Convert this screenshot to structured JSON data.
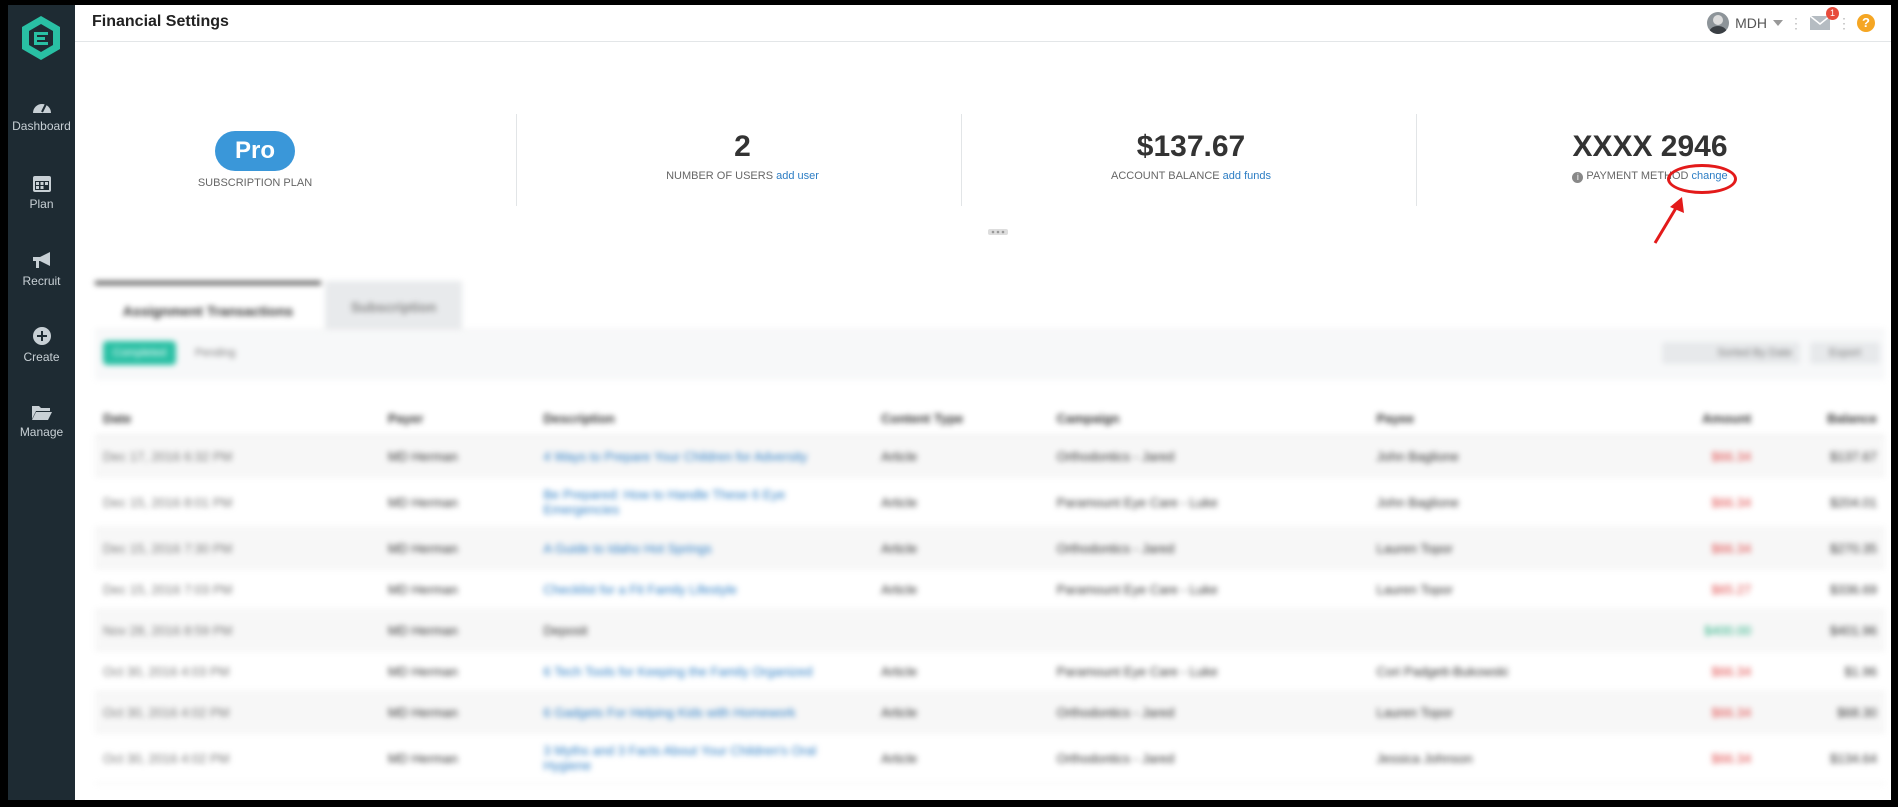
{
  "app": {
    "page_title": "Financial Settings",
    "nav": [
      {
        "label": "Dashboard",
        "icon": "dashboard-icon"
      },
      {
        "label": "Plan",
        "icon": "calendar-icon"
      },
      {
        "label": "Recruit",
        "icon": "megaphone-icon"
      },
      {
        "label": "Create",
        "icon": "plus-circle-icon"
      },
      {
        "label": "Manage",
        "icon": "folder-icon"
      }
    ]
  },
  "topbar": {
    "user_initials": "MDH",
    "notification_count": "1",
    "help_label": "?"
  },
  "stats": {
    "plan": {
      "value": "Pro",
      "caption": "SUBSCRIPTION PLAN"
    },
    "users": {
      "value": "2",
      "caption": "NUMBER OF USERS",
      "link": "add user"
    },
    "balance": {
      "value": "$137.67",
      "caption": "ACCOUNT BALANCE",
      "link": "add funds"
    },
    "payment": {
      "value": "XXXX 2946",
      "caption": "PAYMENT METHOD",
      "link": "change"
    }
  },
  "tabs": [
    "Assignment Transactions",
    "Subscription"
  ],
  "filters": {
    "completed": "Completed",
    "pending": "Pending",
    "sort": "Sorted By Date",
    "export": "Export"
  },
  "table": {
    "headers": [
      "Date",
      "Payer",
      "Description",
      "Content Type",
      "Campaign",
      "Payee",
      "Amount",
      "Balance"
    ],
    "rows": [
      {
        "date": "Dec 17, 2016 6:32 PM",
        "payer": "MD Herman",
        "desc": "4 Ways to Prepare Your Children for Adversity",
        "desc2": "",
        "type": "Article",
        "campaign": "Orthodontics - Jared",
        "payee": "John Baglione",
        "amount": "$66.34",
        "balance": "$137.67",
        "kind": "neg"
      },
      {
        "date": "Dec 15, 2016 8:01 PM",
        "payer": "MD Herman",
        "desc": "Be Prepared: How to Handle These 6 Eye",
        "desc2": "Emergencies",
        "type": "Article",
        "campaign": "Paramount Eye Care - Luke",
        "payee": "John Baglione",
        "amount": "$66.34",
        "balance": "$204.01",
        "kind": "neg"
      },
      {
        "date": "Dec 15, 2016 7:30 PM",
        "payer": "MD Herman",
        "desc": "A Guide to Idaho Hot Springs",
        "desc2": "",
        "type": "Article",
        "campaign": "Orthodontics - Jared",
        "payee": "Lauren Topor",
        "amount": "$66.34",
        "balance": "$270.35",
        "kind": "neg"
      },
      {
        "date": "Dec 15, 2016 7:03 PM",
        "payer": "MD Herman",
        "desc": "Checklist for a Fit Family Lifestyle",
        "desc2": "",
        "type": "Article",
        "campaign": "Paramount Eye Care - Luke",
        "payee": "Lauren Topor",
        "amount": "$65.27",
        "balance": "$336.69",
        "kind": "neg"
      },
      {
        "date": "Nov 28, 2016 8:59 PM",
        "payer": "MD Herman",
        "desc": "Deposit",
        "desc2": "",
        "type": "",
        "campaign": "",
        "payee": "",
        "amount": "$400.00",
        "balance": "$401.96",
        "kind": "pos"
      },
      {
        "date": "Oct 30, 2016 4:03 PM",
        "payer": "MD Herman",
        "desc": "6 Tech Tools for Keeping the Family Organized",
        "desc2": "",
        "type": "Article",
        "campaign": "Paramount Eye Care - Luke",
        "payee": "Cori Padgett-Bukowski",
        "amount": "$66.34",
        "balance": "$1.96",
        "kind": "neg"
      },
      {
        "date": "Oct 30, 2016 4:02 PM",
        "payer": "MD Herman",
        "desc": "6 Gadgets For Helping Kids with Homework",
        "desc2": "",
        "type": "Article",
        "campaign": "Orthodontics - Jared",
        "payee": "Lauren Topor",
        "amount": "$66.34",
        "balance": "$68.30",
        "kind": "neg"
      },
      {
        "date": "Oct 30, 2016 4:02 PM",
        "payer": "MD Herman",
        "desc": "3 Myths and 3 Facts About Your Children's Oral",
        "desc2": "Hygiene",
        "type": "Article",
        "campaign": "Orthodontics - Jared",
        "payee": "Jessica Johnson",
        "amount": "$66.34",
        "balance": "$134.64",
        "kind": "neg"
      }
    ]
  },
  "colors": {
    "sidebar": "#1e2b33",
    "accent": "#3a97d9",
    "logo": "#29c0a4",
    "annotation": "#e31a1a"
  }
}
